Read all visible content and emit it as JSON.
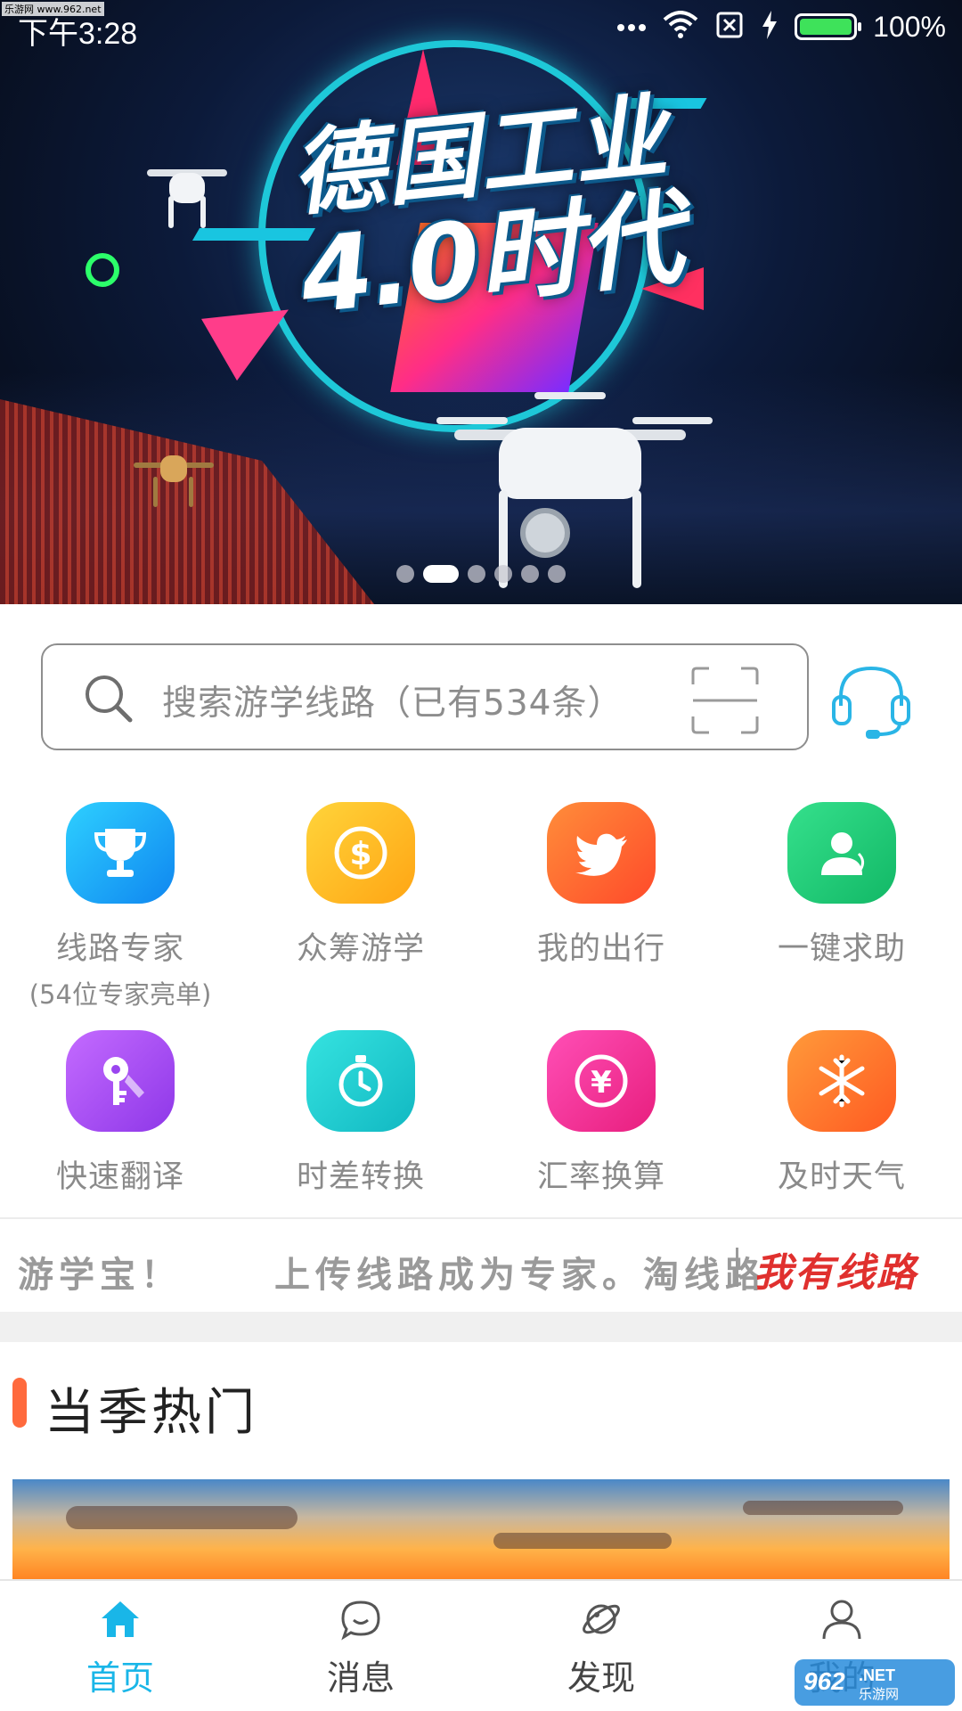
{
  "watermark": "乐游网 www.962.net",
  "status_bar": {
    "time": "下午3:28",
    "battery_percent": "100%",
    "battery_color": "#3ee25a"
  },
  "banner": {
    "title_line1": "德国工业",
    "title_line2": "4.0时代",
    "page_count": 6,
    "active_index": 1
  },
  "search": {
    "placeholder": "搜索游学线路（已有534条）",
    "icons": [
      "search-icon",
      "scan-icon",
      "headset-icon"
    ]
  },
  "grid": [
    {
      "label": "线路专家",
      "sub": "(54位专家亮单)",
      "icon": "trophy-icon",
      "color_from": "#2ed0ff",
      "color_to": "#0f86f0"
    },
    {
      "label": "众筹游学",
      "sub": "",
      "icon": "dollar-coin-icon",
      "color_from": "#ffd43a",
      "color_to": "#ffa514"
    },
    {
      "label": "我的出行",
      "sub": "",
      "icon": "bird-icon",
      "color_from": "#ff8d3a",
      "color_to": "#ff4a2a"
    },
    {
      "label": "一键求助",
      "sub": "",
      "icon": "contact-icon",
      "color_from": "#35e08c",
      "color_to": "#12b866"
    },
    {
      "label": "快速翻译",
      "sub": "",
      "icon": "key-icon",
      "color_from": "#c46bff",
      "color_to": "#8e37e8"
    },
    {
      "label": "时差转换",
      "sub": "",
      "icon": "stopwatch-icon",
      "color_from": "#35e3e0",
      "color_to": "#11b8c2"
    },
    {
      "label": "汇率换算",
      "sub": "",
      "icon": "yen-coin-icon",
      "color_from": "#ff4fb6",
      "color_to": "#e81e7e"
    },
    {
      "label": "及时天气",
      "sub": "",
      "icon": "snowflake-icon",
      "color_from": "#ff9a3a",
      "color_to": "#ff5a22"
    }
  ],
  "ticker": {
    "text_1": "游学宝！",
    "text_2": "上传线路成为专家。淘线路",
    "cta": "我有线路",
    "cta_color": "#e0302e"
  },
  "section": {
    "title": "当季热门",
    "accent_color": "#ff6a3d"
  },
  "bottom_nav": {
    "active_color": "#19b6e8",
    "items": [
      {
        "label": "首页",
        "icon": "home-icon"
      },
      {
        "label": "消息",
        "icon": "chat-icon"
      },
      {
        "label": "发现",
        "icon": "planet-icon"
      },
      {
        "label": "我的",
        "icon": "user-icon"
      }
    ]
  },
  "corner_logo": "962.NET 乐游网"
}
